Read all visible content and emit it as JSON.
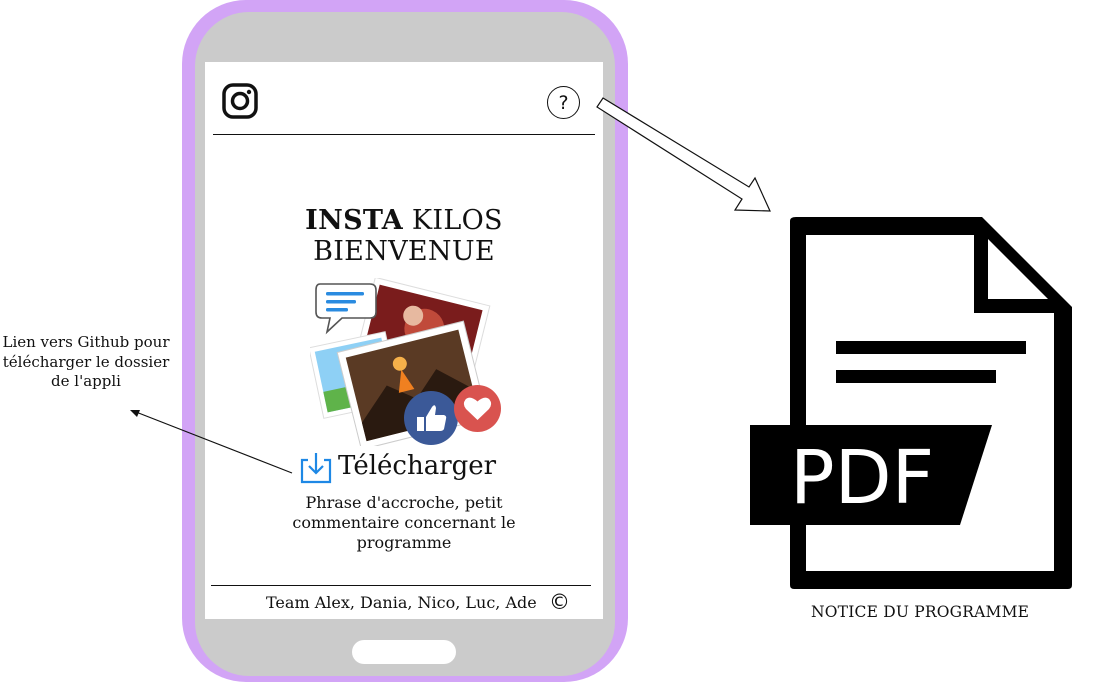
{
  "screen": {
    "help_icon_text": "?",
    "title_bold": "INSTA",
    "title_rest": "KILOS",
    "subtitle": "BIENVENUE",
    "download_label": "Télécharger",
    "tagline": "Phrase d'accroche, petit commentaire concernant le programme",
    "footer_text": "Team Alex, Dania, Nico, Luc, Ade",
    "copyright_symbol": "©"
  },
  "annotations": {
    "github_note": "Lien vers Github pour télécharger le dossier de l'appli",
    "pdf_label": "NOTICE DU PROGRAMME"
  },
  "pdf_icon": {
    "text": "PDF"
  },
  "colors": {
    "phone_frame": "#d2a4f6",
    "phone_body": "#cbcbcb",
    "download_accent": "#1e88e5",
    "like_badge": "#3b5998",
    "heart_badge": "#d9534f"
  }
}
